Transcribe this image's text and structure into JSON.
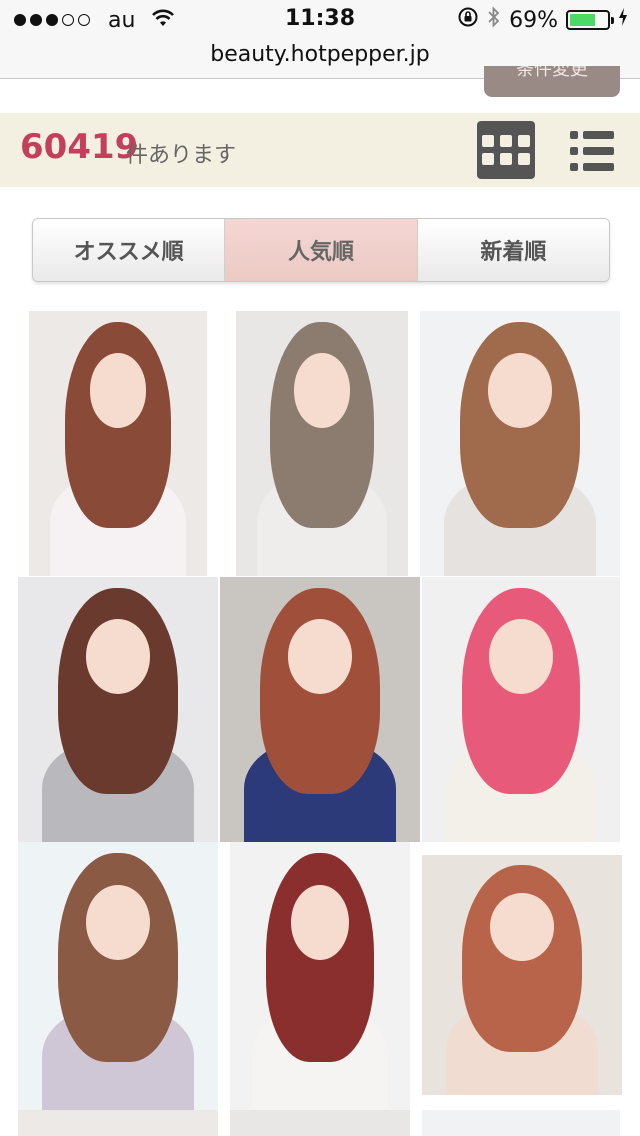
{
  "status_bar": {
    "carrier": "au",
    "time": "11:38",
    "battery_percent": "69%",
    "battery_level": 0.69,
    "signal_dots_filled": 3,
    "signal_dots_total": 5
  },
  "browser": {
    "url": "beauty.hotpepper.jp"
  },
  "condition_button": {
    "label": "条件変更"
  },
  "results": {
    "count": "60419",
    "count_suffix": "件あります"
  },
  "view_toggle": {
    "grid_icon": "grid-view-icon",
    "list_icon": "list-view-icon",
    "active": "grid"
  },
  "sort_tabs": [
    {
      "label": "オススメ順",
      "active": false
    },
    {
      "label": "人気順",
      "active": true
    },
    {
      "label": "新着順",
      "active": false
    }
  ],
  "colors": {
    "accent_count": "#c4405a",
    "count_bar_bg": "#f4f0e1",
    "active_tab_bg": "#eccac4",
    "battery_green": "#4cd964"
  },
  "photos": [
    {
      "hair": "#8a4a38",
      "bg": "#ece9e7",
      "shirt": "#f6f2f3"
    },
    {
      "hair": "#8c7c70",
      "bg": "#e9e6e6",
      "shirt": "#efecec"
    },
    {
      "hair": "#a06a4c",
      "bg": "#f0f2f4",
      "shirt": "#e6e2df"
    },
    {
      "hair": "#6a3a2e",
      "bg": "#e8e8ea",
      "shirt": "#b9b9bd"
    },
    {
      "hair": "#a0503a",
      "bg": "#c9c6c2",
      "shirt": "#2c3a7a"
    },
    {
      "hair": "#e85a7a",
      "bg": "#f0f0f0",
      "shirt": "#f3f0ea"
    },
    {
      "hair": "#8a5a44",
      "bg": "#eef3f6",
      "shirt": "#cfc6d6"
    },
    {
      "hair": "#8a2e2e",
      "bg": "#f2f2f2",
      "shirt": "#f6f3f3"
    },
    {
      "hair": "#b8644a",
      "bg": "#e9e3de",
      "shirt": "#f0dcd0"
    }
  ]
}
